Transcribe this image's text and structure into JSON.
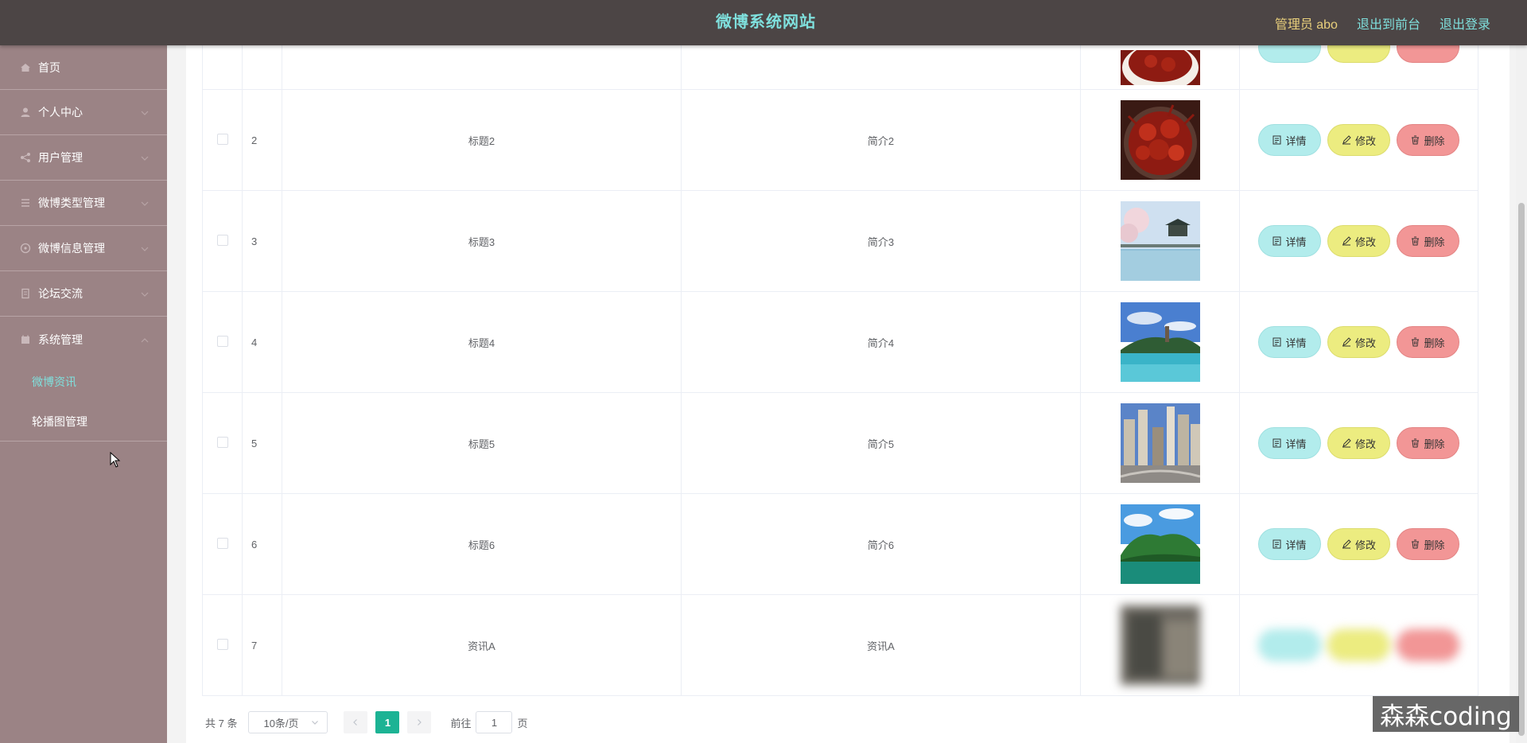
{
  "header": {
    "title": "微博系统网站",
    "admin": "管理员 abo",
    "to_front": "退出到前台",
    "logout": "退出登录"
  },
  "sidebar": {
    "items": [
      {
        "label": "首页",
        "icon": "home-icon"
      },
      {
        "label": "个人中心",
        "icon": "user-icon"
      },
      {
        "label": "用户管理",
        "icon": "share-icon"
      },
      {
        "label": "微博类型管理",
        "icon": "list-icon"
      },
      {
        "label": "微博信息管理",
        "icon": "compass-icon"
      },
      {
        "label": "论坛交流",
        "icon": "document-icon"
      },
      {
        "label": "系统管理",
        "icon": "calendar-icon"
      }
    ],
    "subitems": [
      {
        "label": "微博资讯",
        "active": true
      },
      {
        "label": "轮播图管理",
        "active": false
      }
    ]
  },
  "table": {
    "rows": [
      {
        "idx": "2",
        "title": "标题2",
        "intro": "简介2",
        "image": "crayfish"
      },
      {
        "idx": "3",
        "title": "标题3",
        "intro": "简介3",
        "image": "pavilion"
      },
      {
        "idx": "4",
        "title": "标题4",
        "intro": "简介4",
        "image": "lake"
      },
      {
        "idx": "5",
        "title": "标题5",
        "intro": "简介5",
        "image": "city"
      },
      {
        "idx": "6",
        "title": "标题6",
        "intro": "简介6",
        "image": "mountain"
      },
      {
        "idx": "7",
        "title": "资讯A",
        "intro": "资讯A",
        "image": "blurred"
      }
    ],
    "buttons": {
      "detail": "详情",
      "edit": "修改",
      "delete": "删除"
    }
  },
  "pagination": {
    "total": "共 7 条",
    "page_size": "10条/页",
    "current_page": "1",
    "goto_label": "前往",
    "goto_value": "1",
    "page_unit": "页"
  },
  "watermark": "森森coding",
  "colors": {
    "header_bg": "#4c4545",
    "title": "#7fe0dd",
    "admin": "#e9d07c",
    "sidebar_bg": "#9b8385",
    "detail_btn": "#b2ecec",
    "edit_btn": "#ecec80",
    "delete_btn": "#f29696",
    "page_active": "#1cb394"
  }
}
